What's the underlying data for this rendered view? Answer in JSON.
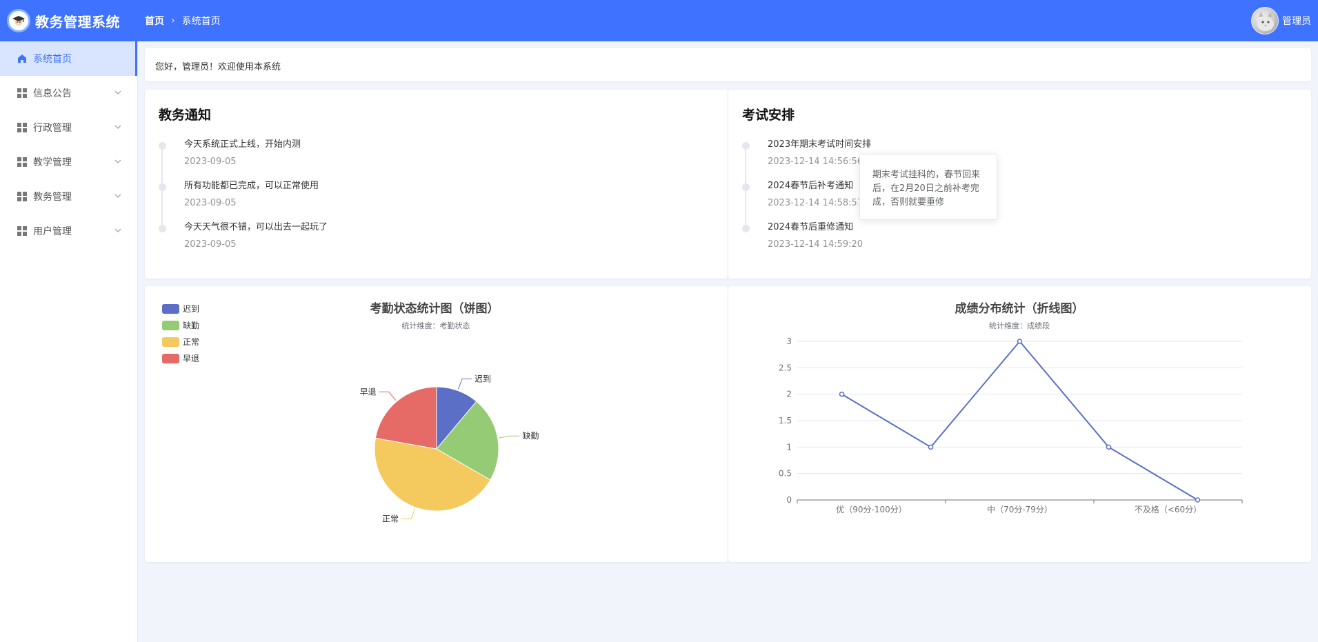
{
  "app": {
    "title": "教务管理系统"
  },
  "breadcrumb": {
    "home": "首页",
    "separator": "›",
    "current": "系统首页"
  },
  "user": {
    "name": "管理员"
  },
  "sidebar": {
    "items": [
      {
        "label": "系统首页",
        "icon": "home-icon",
        "active": true
      },
      {
        "label": "信息公告",
        "icon": "grid-icon"
      },
      {
        "label": "行政管理",
        "icon": "grid-icon"
      },
      {
        "label": "教学管理",
        "icon": "grid-icon"
      },
      {
        "label": "教务管理",
        "icon": "grid-icon"
      },
      {
        "label": "用户管理",
        "icon": "grid-icon"
      }
    ]
  },
  "welcome": {
    "text": "您好，管理员！欢迎使用本系统"
  },
  "notices": {
    "title": "教务通知",
    "items": [
      {
        "text": "今天系统正式上线，开始内测",
        "date": "2023-09-05"
      },
      {
        "text": "所有功能都已完成，可以正常使用",
        "date": "2023-09-05"
      },
      {
        "text": "今天天气很不错，可以出去一起玩了",
        "date": "2023-09-05"
      }
    ]
  },
  "exams": {
    "title": "考试安排",
    "items": [
      {
        "text": "2023年期末考试时间安排",
        "date": "2023-12-14 14:56:56"
      },
      {
        "text": "2024春节后补考通知",
        "date": "2023-12-14 14:58:57"
      },
      {
        "text": "2024春节后重修通知",
        "date": "2023-12-14 14:59:20"
      }
    ],
    "tooltip": "期末考试挂科的，春节回来后，在2月20日之前补考完成，否则就要重修"
  },
  "colors": {
    "primary": "#3f72ff",
    "blue": "#5b6fc7",
    "green": "#94cb74",
    "yellow": "#f4c95d",
    "red": "#e66a66"
  },
  "chart_data": [
    {
      "type": "pie",
      "title": "考勤状态统计图（饼图）",
      "subtitle": "统计维度：考勤状态",
      "legend_position": "top-left",
      "slices": [
        {
          "name": "迟到",
          "value": 1,
          "color": "#5b6fc7"
        },
        {
          "name": "缺勤",
          "value": 2,
          "color": "#94cb74"
        },
        {
          "name": "正常",
          "value": 4,
          "color": "#f4c95d"
        },
        {
          "name": "早退",
          "value": 2,
          "color": "#e66a66"
        }
      ]
    },
    {
      "type": "line",
      "title": "成绩分布统计（折线图）",
      "subtitle": "统计维度：成绩段",
      "x_tick_labels": [
        "优（90分-100分）",
        "中（70分-79分）",
        "不及格（<60分）"
      ],
      "series": [
        {
          "values": [
            2,
            1,
            3,
            1,
            0
          ],
          "color": "#5b6fc7"
        }
      ],
      "ylim": [
        0,
        3
      ],
      "y_ticks": [
        "0",
        "0.5",
        "1",
        "1.5",
        "2",
        "2.5",
        "3"
      ],
      "grid": true
    }
  ]
}
